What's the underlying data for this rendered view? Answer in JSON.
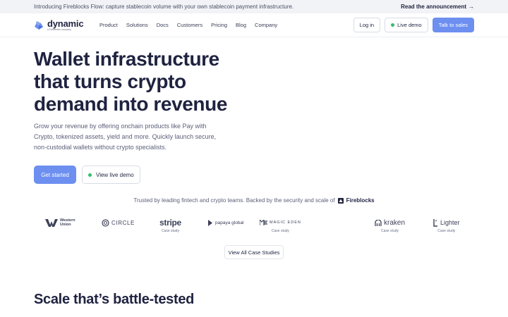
{
  "announcement": {
    "message": "Introducing Fireblocks Flow: capture stablecoin volume with your own stablecoin payment infrastructure.",
    "link_label": "Read the announcement",
    "link_arrow": "→"
  },
  "nav": {
    "logo_word": "dynamic",
    "logo_sub": "a Fireblocks company",
    "items": [
      {
        "label": "Product"
      },
      {
        "label": "Solutions"
      },
      {
        "label": "Docs"
      },
      {
        "label": "Customers"
      },
      {
        "label": "Pricing"
      },
      {
        "label": "Blog"
      },
      {
        "label": "Company"
      }
    ],
    "login_label": "Log in",
    "live_demo_label": "Live demo",
    "sales_label": "Talk to sales"
  },
  "hero": {
    "title_lines": [
      "Wallet infrastructure",
      "that turns crypto",
      "demand into revenue"
    ],
    "subtitle": "Grow your revenue by offering onchain products like Pay with Crypto, tokenized assets, yield and more. Quickly launch secure, non-custodial wallets without crypto specialists.",
    "primary_cta": "Get started",
    "secondary_cta": "View live demo"
  },
  "trusted": {
    "text": "Trusted by leading fintech and crypto teams.  Backed by the security and scale of",
    "brand": "Fireblocks"
  },
  "logos": {
    "western_union": "Western Union",
    "western_union_line1": "Western",
    "western_union_line2": "Union",
    "circle": "CIRCLE",
    "stripe": "stripe",
    "papaya": "papaya global",
    "magic_eden": "MAGIC EDEN",
    "kraken": "kraken",
    "lighter": "Lighter",
    "case_study_label": "Case study"
  },
  "view_all_label": "View All Case Studies",
  "section_title": "Scale that’s battle-tested",
  "colors": {
    "primary": "#6c8ff0",
    "text": "#1f2340",
    "live_dot": "#2fbf71"
  }
}
